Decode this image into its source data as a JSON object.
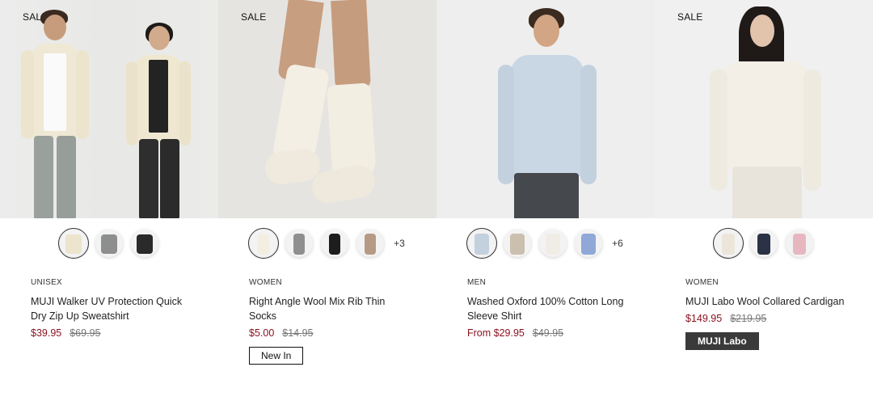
{
  "products": [
    {
      "badge": "SALE",
      "image_alt": "Two models wearing cream zip up sweatshirts",
      "swatches": [
        "cream",
        "gray",
        "black"
      ],
      "more_colors": "",
      "category": "UNISEX",
      "name": "MUJI Walker UV Protection Quick Dry Zip Up Sweatshirt",
      "price": "$39.95",
      "original_price": "$69.95",
      "tag": ""
    },
    {
      "badge": "SALE",
      "image_alt": "Cream rib socks",
      "swatches": [
        "off-white",
        "gray",
        "black",
        "mocha"
      ],
      "more_colors": "+3",
      "category": "WOMEN",
      "name": "Right Angle Wool Mix Rib Thin Socks",
      "price": "$5.00",
      "original_price": "$14.95",
      "tag": "New In"
    },
    {
      "badge": "",
      "image_alt": "Model wearing light blue oxford shirt",
      "swatches": [
        "light-blue",
        "beige",
        "white",
        "blue"
      ],
      "more_colors": "+6",
      "category": "MEN",
      "name": "Washed Oxford 100% Cotton Long Sleeve Shirt",
      "price": "From $29.95",
      "original_price": "$49.95",
      "tag": ""
    },
    {
      "badge": "SALE",
      "image_alt": "Model wearing cream wool collared cardigan",
      "swatches": [
        "cream",
        "navy",
        "pink"
      ],
      "more_colors": "",
      "category": "WOMEN",
      "name": "MUJI Labo Wool Collared Cardigan",
      "price": "$149.95",
      "original_price": "$219.95",
      "tag": "MUJI Labo"
    }
  ],
  "colors": {
    "sale_price": "#8a0f1e",
    "tag_dark": "#3a3a3a"
  }
}
